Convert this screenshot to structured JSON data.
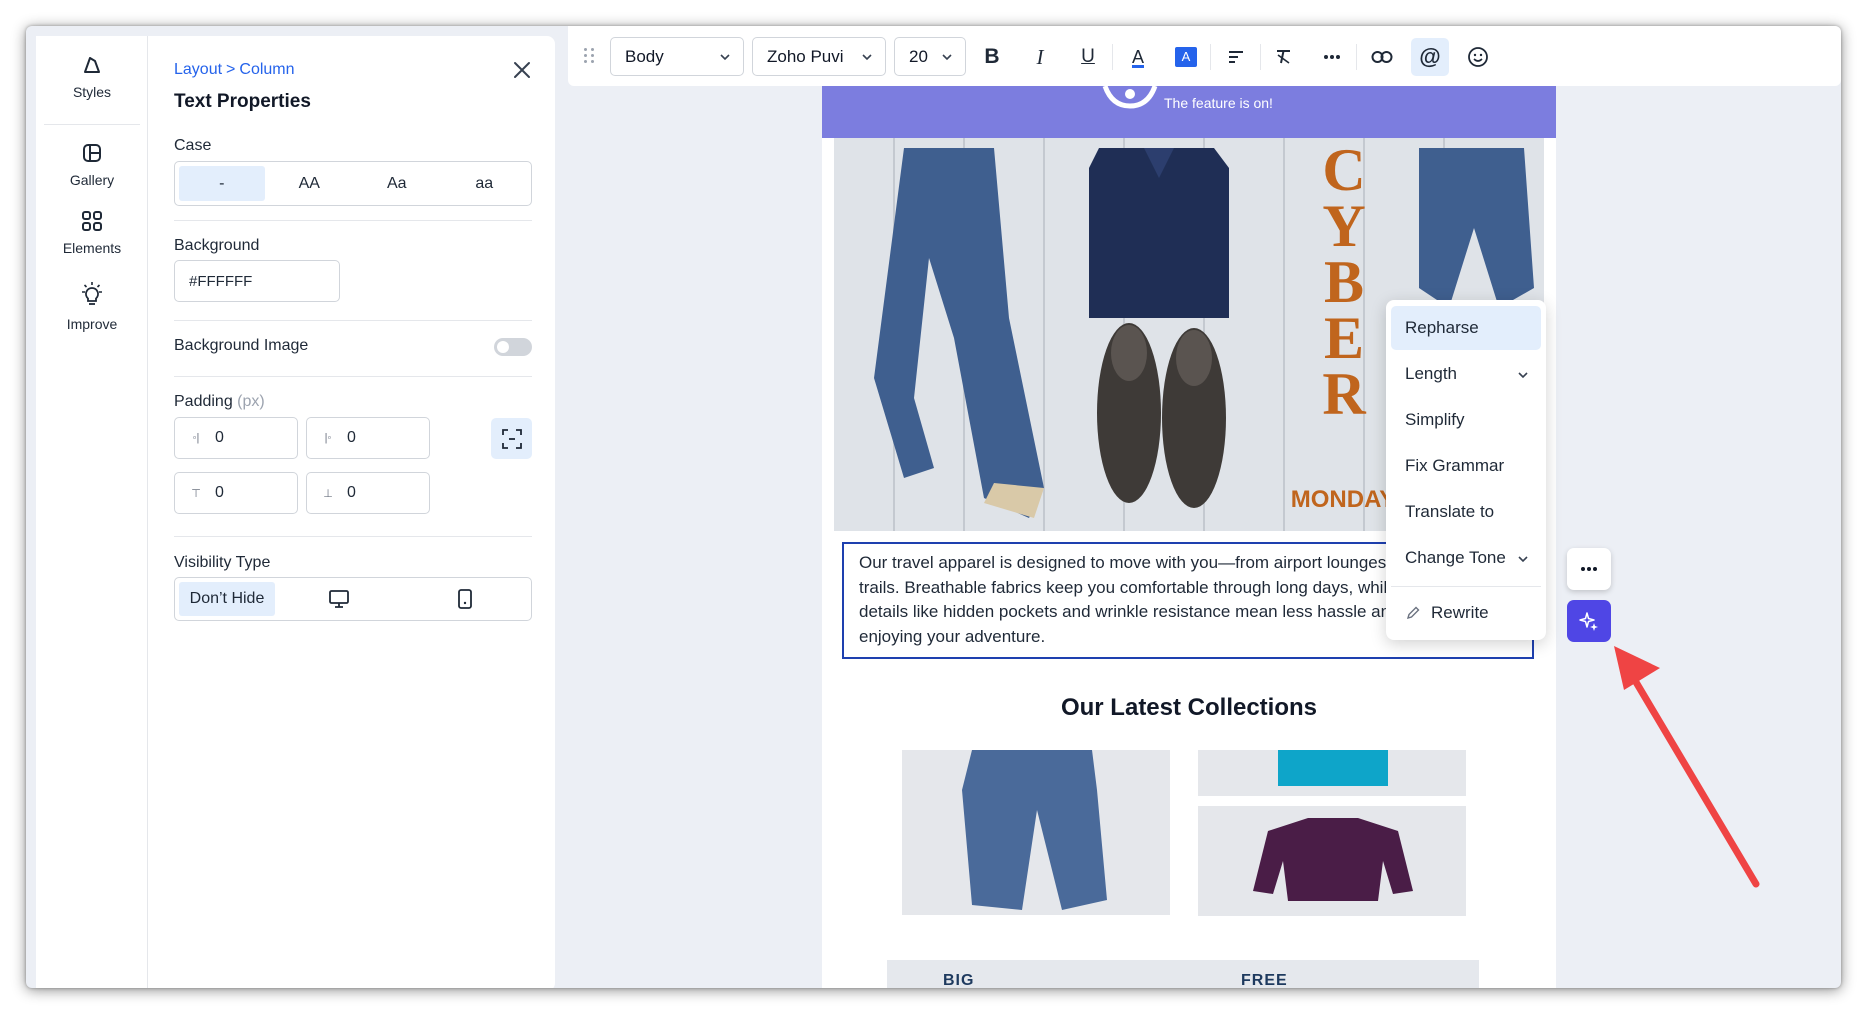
{
  "rail": {
    "items": [
      {
        "label": "Styles",
        "icon": "styles-icon"
      },
      {
        "label": "Gallery",
        "icon": "gallery-icon"
      },
      {
        "label": "Elements",
        "icon": "elements-icon"
      },
      {
        "label": "Improve",
        "icon": "lightbulb-icon"
      }
    ]
  },
  "panel": {
    "breadcrumb": {
      "parent": "Layout",
      "separator": ">",
      "current": "Column"
    },
    "title": "Text Properties",
    "case": {
      "label": "Case",
      "options": [
        "-",
        "AA",
        "Aa",
        "aa"
      ],
      "selected": "-"
    },
    "background": {
      "label": "Background",
      "value": "#FFFFFF"
    },
    "background_image": {
      "label": "Background Image",
      "enabled": false
    },
    "padding": {
      "label": "Padding",
      "unit": "(px)",
      "left": "0",
      "right": "0",
      "top": "0",
      "bottom": "0"
    },
    "visibility": {
      "label": "Visibility Type",
      "options": [
        "Don't Hide",
        "desktop-icon",
        "mobile-icon"
      ],
      "selected": "Don't Hide",
      "dont_hide_label": "Don’t Hide"
    }
  },
  "toolbar": {
    "style_select": "Body",
    "font_select": "Zoho Puvi",
    "size_select": "20",
    "buttons": [
      "bold-icon",
      "italic-icon",
      "underline-icon",
      "text-color-icon",
      "highlight-color-icon",
      "align-icon",
      "clear-format-icon",
      "more-icon",
      "link-icon",
      "mention-icon",
      "emoji-icon"
    ],
    "bold_glyph": "B",
    "italic_glyph": "I",
    "underline_glyph": "U",
    "text_color_glyph": "A",
    "highlight_glyph": "A",
    "mention_glyph": "@",
    "accent_color": "#2563eb"
  },
  "email": {
    "banner_text": "The feature is on!",
    "banner_color": "#7c7ddf",
    "hero": {
      "word_1": "CYBER",
      "word_2": "MONDAY",
      "letters": [
        "C",
        "Y",
        "B",
        "E",
        "R"
      ]
    },
    "body_text": "Our travel apparel is designed to move with you—from airport lounges to mountain trails. Breathable fabrics keep you comfortable through long days, while thoughtful details like hidden pockets and wrinkle resistance mean less hassle and more time enjoying your adventure.",
    "collections_title": "Our Latest Collections",
    "promo_left": "BIG\nSHOPPING",
    "promo_right": "FREE\nSHIPPING"
  },
  "ai_menu": {
    "items": [
      "Repharse",
      "Length",
      "Simplify",
      "Fix Grammar",
      "Translate to",
      "Change Tone"
    ],
    "rewrite": "Rewrite",
    "active": "Repharse",
    "button_color": "#4f46e5"
  },
  "annotation": {
    "arrow_color": "#ef4444"
  }
}
